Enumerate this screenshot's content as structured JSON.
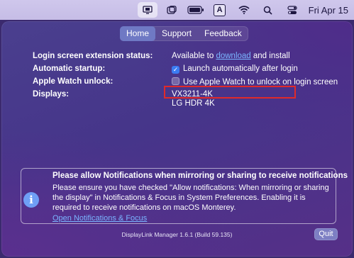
{
  "menubar": {
    "icons": [
      "display-mirror-icon",
      "window-icon",
      "battery-icon",
      "keyboard-input-icon",
      "wifi-icon",
      "search-icon",
      "control-center-icon"
    ],
    "input_source": "A",
    "date": "Fri Apr 15"
  },
  "tabs": [
    {
      "label": "Home",
      "selected": true
    },
    {
      "label": "Support",
      "selected": false
    },
    {
      "label": "Feedback",
      "selected": false
    }
  ],
  "settings": {
    "login_ext": {
      "label": "Login screen extension status:",
      "value_prefix": "Available to ",
      "link": "download",
      "value_suffix": " and install"
    },
    "startup": {
      "label": "Automatic startup:",
      "checkbox_label": "Launch automatically after login",
      "checked": true
    },
    "watch": {
      "label": "Apple Watch unlock:",
      "checkbox_label": "Use Apple Watch to unlock on login screen",
      "checked": false
    },
    "displays": {
      "label": "Displays:",
      "items": [
        "VX3211-4K",
        "LG HDR 4K"
      ]
    }
  },
  "notice": {
    "title": "Please allow Notifications when mirroring or sharing to receive notifications",
    "body": "Please ensure you have checked \"Allow notifications: When mirroring or sharing the display\" in Notifications & Focus in System Preferences. Enabling it is required to receive notifications on macOS Monterey.",
    "link": "Open Notifications & Focus"
  },
  "footer": {
    "version": "DisplayLink Manager 1.6.1 (Build 59.135)",
    "quit_label": "Quit"
  },
  "colors": {
    "accent": "#6f79c4",
    "link": "#7ab4ff",
    "highlight_border": "#e02a2a",
    "checkbox_on": "#3b7cf2"
  }
}
